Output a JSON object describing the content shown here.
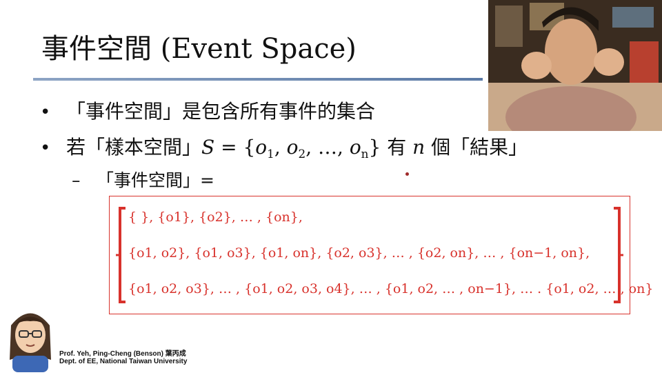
{
  "slide": {
    "title": "事件空間 (Event Space)",
    "bullets": [
      {
        "marker": "•",
        "text": "「事件空間」是包含所有事件的集合"
      },
      {
        "marker": "•",
        "text_before": "若「樣本空間」",
        "math": "S = {o1, o2, …, on}",
        "text_middle": "有",
        "math_n": "n",
        "text_after": "個「結果」"
      }
    ],
    "sub_bullet": {
      "marker": "–",
      "text": "「事件空間」="
    },
    "set_lines": [
      "{ }, {o1}, {o2}, … , {on},",
      "{o1, o2}, {o1, o3}, {o1, on}, {o2, o3}, … , {o2, on}, … , {on−1, on},",
      "{o1, o2, o3}, … , {o1, o2, o3, o4}, … , {o1, o2, … , on−1}, … . {o1, o2, … , on}"
    ],
    "accent_color": "#d8322c",
    "rule_color": "#5b7aa6"
  },
  "footer": {
    "name": "Prof. Yeh, Ping-Cheng (Benson) 葉丙成",
    "dept": "Dept. of EE,  National Taiwan University"
  },
  "webcam": {
    "icon": "presenter-video-feed"
  }
}
